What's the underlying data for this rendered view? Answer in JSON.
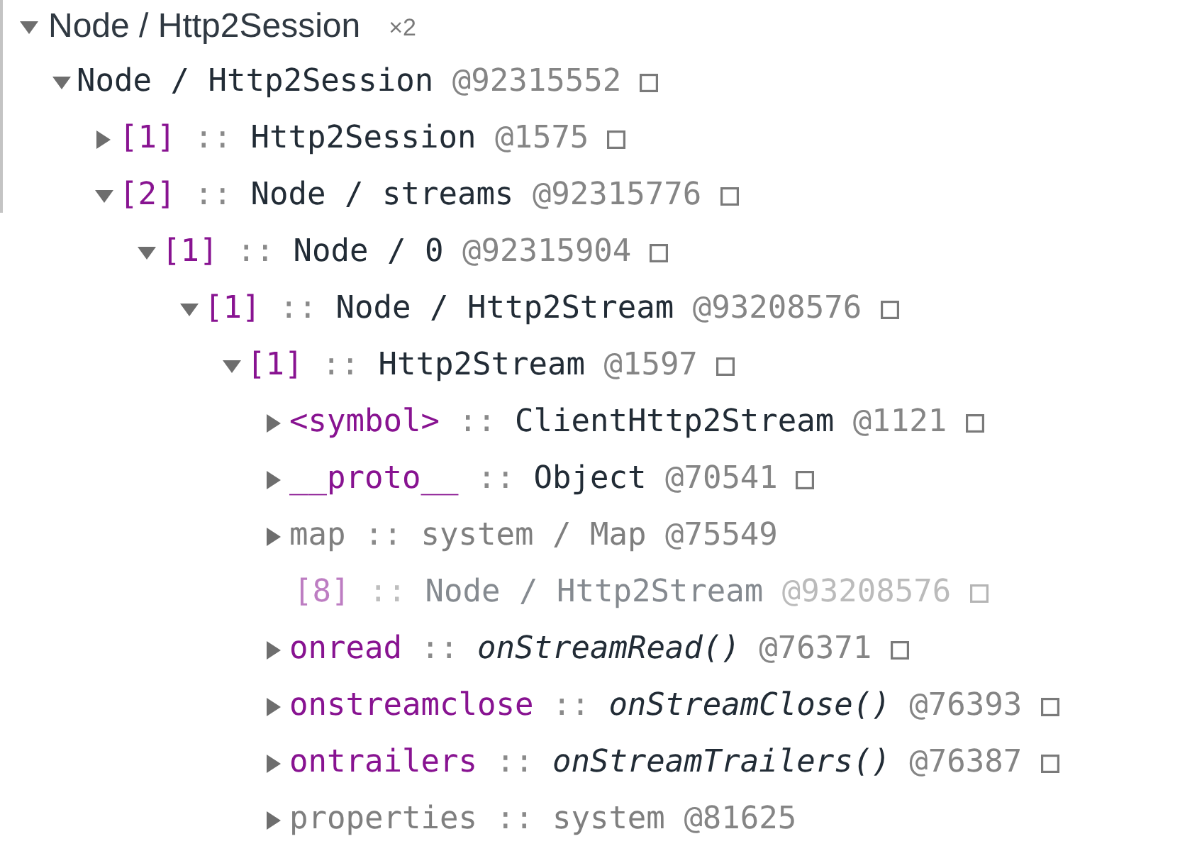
{
  "group": {
    "label": "Node / Http2Session",
    "count": "×2",
    "expanded": true
  },
  "tree": [
    {
      "expanded": true,
      "leaf": false,
      "kind": "object",
      "type": "Node / Http2Session",
      "id": "@92315552",
      "reveal": true,
      "dimmed": false,
      "children": [
        {
          "expanded": false,
          "leaf": false,
          "name": "[1]",
          "separator": "::",
          "kind": "object",
          "type": "Http2Session",
          "id": "@1575",
          "reveal": true,
          "dimmed": false
        },
        {
          "expanded": true,
          "leaf": false,
          "name": "[2]",
          "separator": "::",
          "kind": "object",
          "type": "Node / streams",
          "id": "@92315776",
          "reveal": true,
          "dimmed": false,
          "children": [
            {
              "expanded": true,
              "leaf": false,
              "name": "[1]",
              "separator": "::",
              "kind": "object",
              "type": "Node / 0",
              "id": "@92315904",
              "reveal": true,
              "dimmed": false,
              "children": [
                {
                  "expanded": true,
                  "leaf": false,
                  "name": "[1]",
                  "separator": "::",
                  "kind": "object",
                  "type": "Node / Http2Stream",
                  "id": "@93208576",
                  "reveal": true,
                  "dimmed": false,
                  "children": [
                    {
                      "expanded": true,
                      "leaf": false,
                      "name": "[1]",
                      "separator": "::",
                      "kind": "object",
                      "type": "Http2Stream",
                      "id": "@1597",
                      "reveal": true,
                      "dimmed": false,
                      "children": [
                        {
                          "expanded": false,
                          "leaf": false,
                          "name": "<symbol>",
                          "separator": "::",
                          "kind": "object",
                          "type": "ClientHttp2Stream",
                          "id": "@1121",
                          "reveal": true,
                          "dimmed": false
                        },
                        {
                          "expanded": false,
                          "leaf": false,
                          "name": "__proto__",
                          "separator": "::",
                          "kind": "object",
                          "type": "Object",
                          "id": "@70541",
                          "reveal": true,
                          "dimmed": false
                        },
                        {
                          "expanded": false,
                          "leaf": false,
                          "name": "map",
                          "separator": "::",
                          "kind": "system",
                          "type": "system / Map",
                          "id": "@75549",
                          "reveal": false,
                          "dimmed": false
                        },
                        {
                          "expanded": false,
                          "leaf": true,
                          "name": "[8]",
                          "separator": "::",
                          "kind": "object",
                          "type": "Node / Http2Stream",
                          "id": "@93208576",
                          "reveal": true,
                          "dimmed": true
                        },
                        {
                          "expanded": false,
                          "leaf": false,
                          "name": "onread",
                          "separator": "::",
                          "kind": "function",
                          "type": "onStreamRead()",
                          "id": "@76371",
                          "reveal": true,
                          "dimmed": false
                        },
                        {
                          "expanded": false,
                          "leaf": false,
                          "name": "onstreamclose",
                          "separator": "::",
                          "kind": "function",
                          "type": "onStreamClose()",
                          "id": "@76393",
                          "reveal": true,
                          "dimmed": false
                        },
                        {
                          "expanded": false,
                          "leaf": false,
                          "name": "ontrailers",
                          "separator": "::",
                          "kind": "function",
                          "type": "onStreamTrailers()",
                          "id": "@76387",
                          "reveal": true,
                          "dimmed": false
                        },
                        {
                          "expanded": false,
                          "leaf": false,
                          "name": "properties",
                          "separator": "::",
                          "kind": "system",
                          "type": "system",
                          "id": "@81625",
                          "reveal": false,
                          "dimmed": false
                        }
                      ]
                    }
                  ]
                }
              ]
            }
          ]
        }
      ]
    }
  ]
}
